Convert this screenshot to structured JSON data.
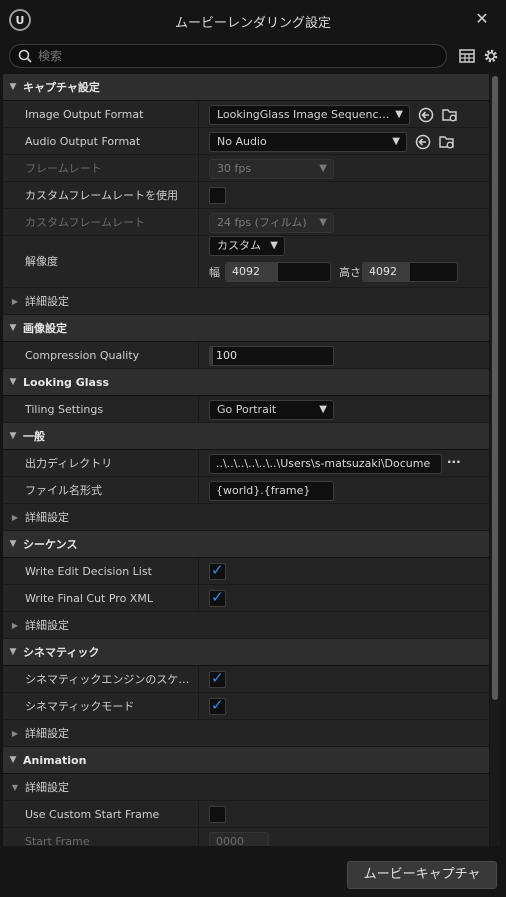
{
  "window": {
    "title": "ムービーレンダリング設定",
    "logo_text": "U"
  },
  "search": {
    "placeholder": "検索"
  },
  "sections": {
    "capture": "キャプチャ設定",
    "image": "画像設定",
    "looking_glass": "Looking Glass",
    "general": "一般",
    "sequence": "シーケンス",
    "cinematic": "シネマティック",
    "animation": "Animation"
  },
  "advanced_label": "詳細設定",
  "capture": {
    "image_output_format": {
      "label": "Image Output Format",
      "value": "LookingGlass Image Sequence (p"
    },
    "audio_output_format": {
      "label": "Audio Output Format",
      "value": "No Audio"
    },
    "frame_rate": {
      "label": "フレームレート",
      "value": "30 fps"
    },
    "use_custom_frame_rate": {
      "label": "カスタムフレームレートを使用",
      "checked": false
    },
    "custom_frame_rate": {
      "label": "カスタムフレームレート",
      "value": "24 fps (フィルム)"
    },
    "resolution": {
      "label": "解像度",
      "preset": "カスタム",
      "width_label": "幅",
      "width": "4092",
      "height_label": "高さ",
      "height": "4092"
    }
  },
  "image": {
    "compression_quality": {
      "label": "Compression Quality",
      "value": "100",
      "fill_fraction": 0.0
    }
  },
  "looking_glass": {
    "tiling_settings": {
      "label": "Tiling Settings",
      "value": "Go Portrait"
    }
  },
  "general": {
    "output_directory": {
      "label": "出力ディレクトリ",
      "value": "..\\..\\..\\..\\..\\..\\Users\\s-matsuzaki\\Docume",
      "browse": "..."
    },
    "filename_format": {
      "label": "ファイル名形式",
      "value": "{world}.{frame}"
    }
  },
  "sequence": {
    "write_edl": {
      "label": "Write Edit Decision List",
      "checked": true
    },
    "write_fcp_xml": {
      "label": "Write Final Cut Pro XML",
      "checked": true
    }
  },
  "cinematic": {
    "scalability": {
      "label": "シネマティックエンジンのスケーラビリティ",
      "checked": true
    },
    "mode": {
      "label": "シネマティックモード",
      "checked": true
    }
  },
  "animation": {
    "use_custom_start_frame": {
      "label": "Use Custom Start Frame",
      "checked": false
    },
    "start_frame": {
      "label": "Start Frame",
      "value": "0000"
    }
  },
  "footer": {
    "capture_button": "ムービーキャプチャ"
  },
  "colors": {
    "accent": "#2f8fe8",
    "panel": "#242424",
    "section": "#2e2e2e",
    "background": "#151515"
  }
}
